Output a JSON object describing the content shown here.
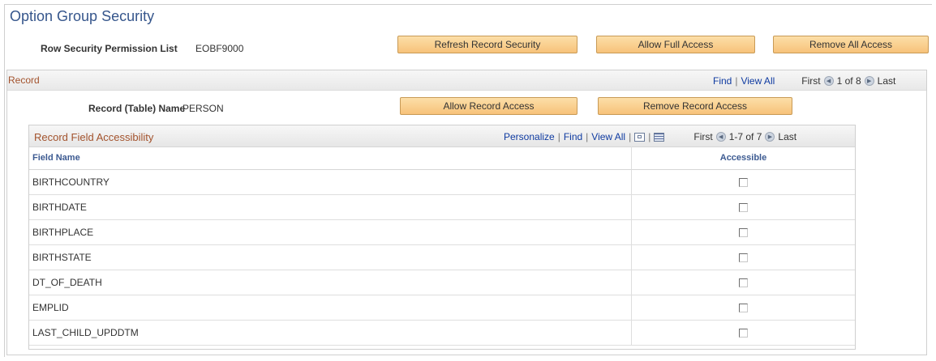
{
  "page": {
    "title": "Option Group Security"
  },
  "permission": {
    "label": "Row Security Permission List",
    "value": "EOBF9000"
  },
  "actions": {
    "refresh": "Refresh Record Security",
    "allow_full": "Allow Full Access",
    "remove_all": "Remove All Access"
  },
  "record": {
    "title": "Record",
    "find": "Find",
    "view_all": "View All",
    "first": "First",
    "count": "1 of 8",
    "last": "Last",
    "name_label": "Record (Table) Name",
    "name_value": "PERSON",
    "allow_btn": "Allow Record Access",
    "remove_btn": "Remove Record Access"
  },
  "grid": {
    "title": "Record Field Accessibility",
    "personalize": "Personalize",
    "find": "Find",
    "view_all": "View All",
    "first": "First",
    "count": "1-7 of 7",
    "last": "Last",
    "columns": {
      "field": "Field Name",
      "accessible": "Accessible"
    },
    "rows": [
      {
        "field": "BIRTHCOUNTRY",
        "accessible": false
      },
      {
        "field": "BIRTHDATE",
        "accessible": false
      },
      {
        "field": "BIRTHPLACE",
        "accessible": false
      },
      {
        "field": "BIRTHSTATE",
        "accessible": false
      },
      {
        "field": "DT_OF_DEATH",
        "accessible": false
      },
      {
        "field": "EMPLID",
        "accessible": false
      },
      {
        "field": "LAST_CHILD_UPDDTM",
        "accessible": false
      }
    ]
  },
  "icons": {
    "prev": "prev-circle-icon",
    "next": "next-circle-icon",
    "zoom": "zoom-grid-icon",
    "download": "download-spreadsheet-icon"
  }
}
